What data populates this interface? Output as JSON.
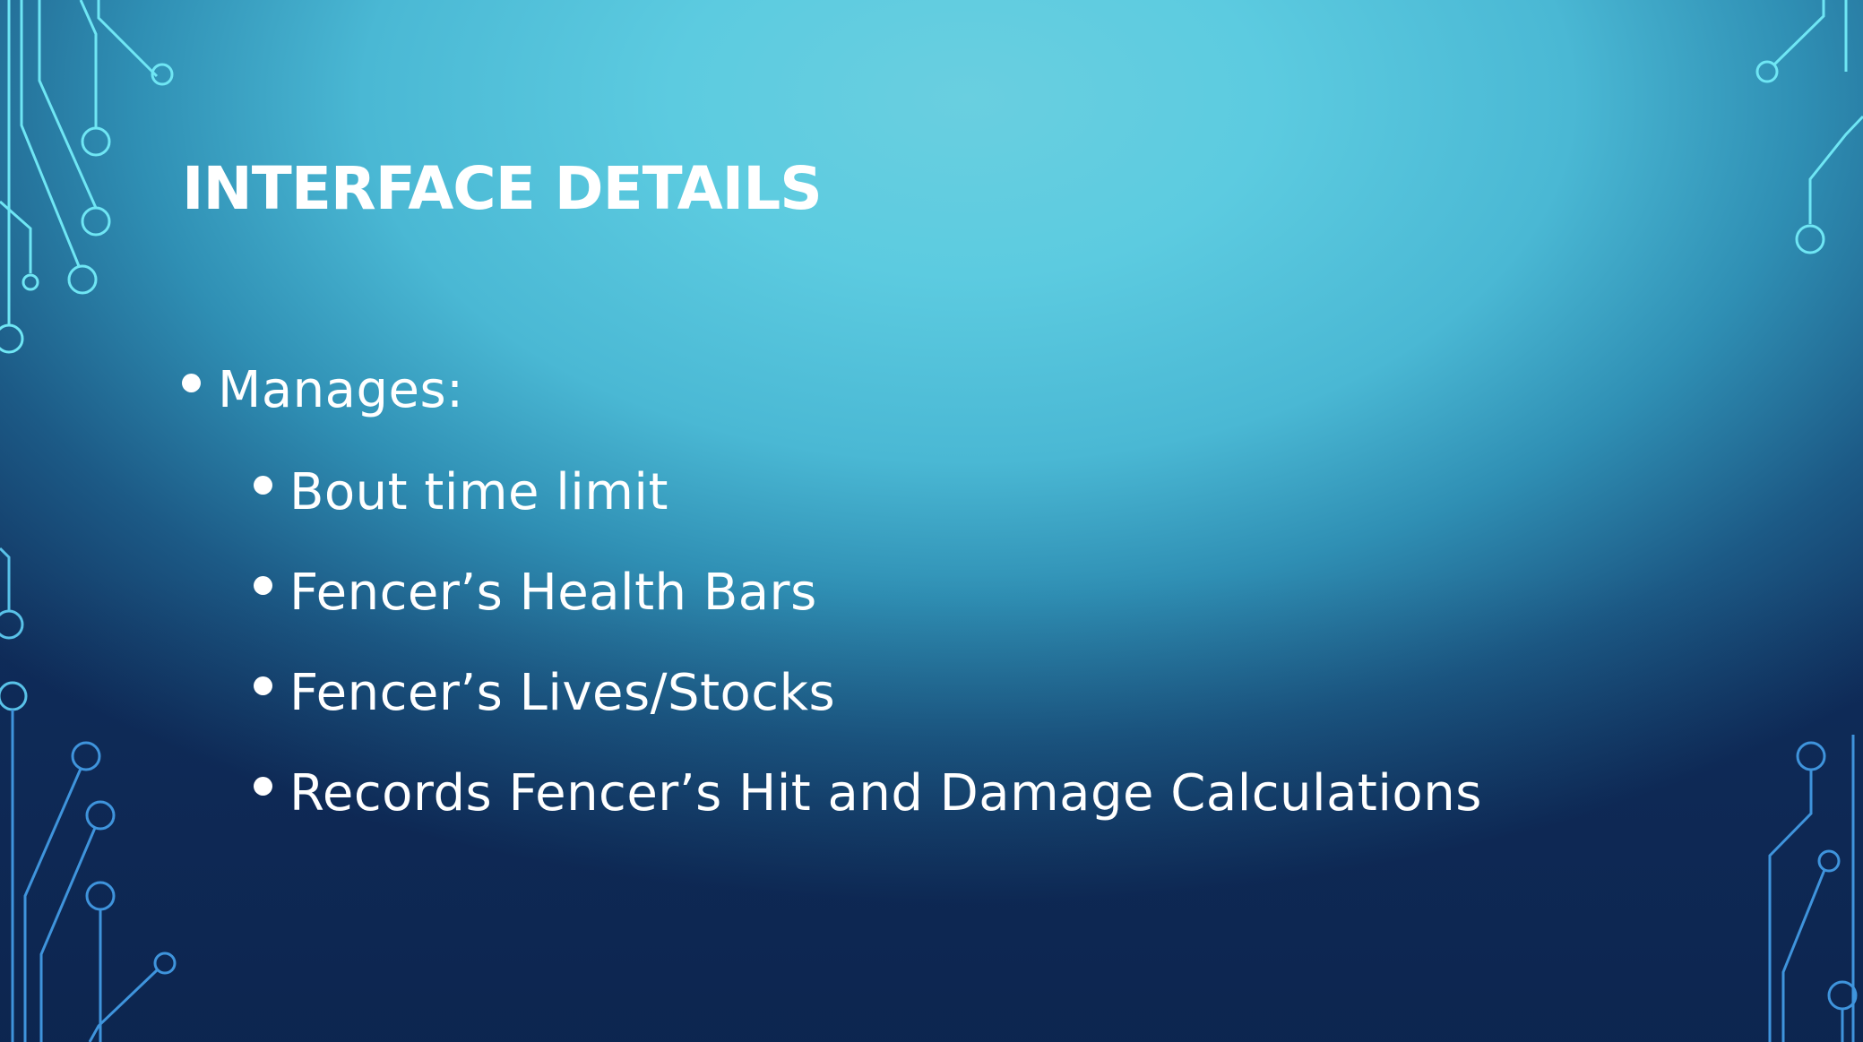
{
  "slide": {
    "title": "INTERFACE DETAILS",
    "bullets": [
      {
        "label": "Manages:",
        "sub_items": [
          "Bout time limit",
          "Fencer’s Health Bars",
          "Fencer’s Lives/Stocks",
          "Records Fencer’s Hit and Damage Calculations"
        ]
      }
    ]
  },
  "theme": {
    "background_light": "#69cfe0",
    "background_dark": "#0f2c5a",
    "text_color": "#ffffff",
    "circuit_color": "#6fe3f2",
    "circuit_color_bottom": "#3d8fd6"
  }
}
